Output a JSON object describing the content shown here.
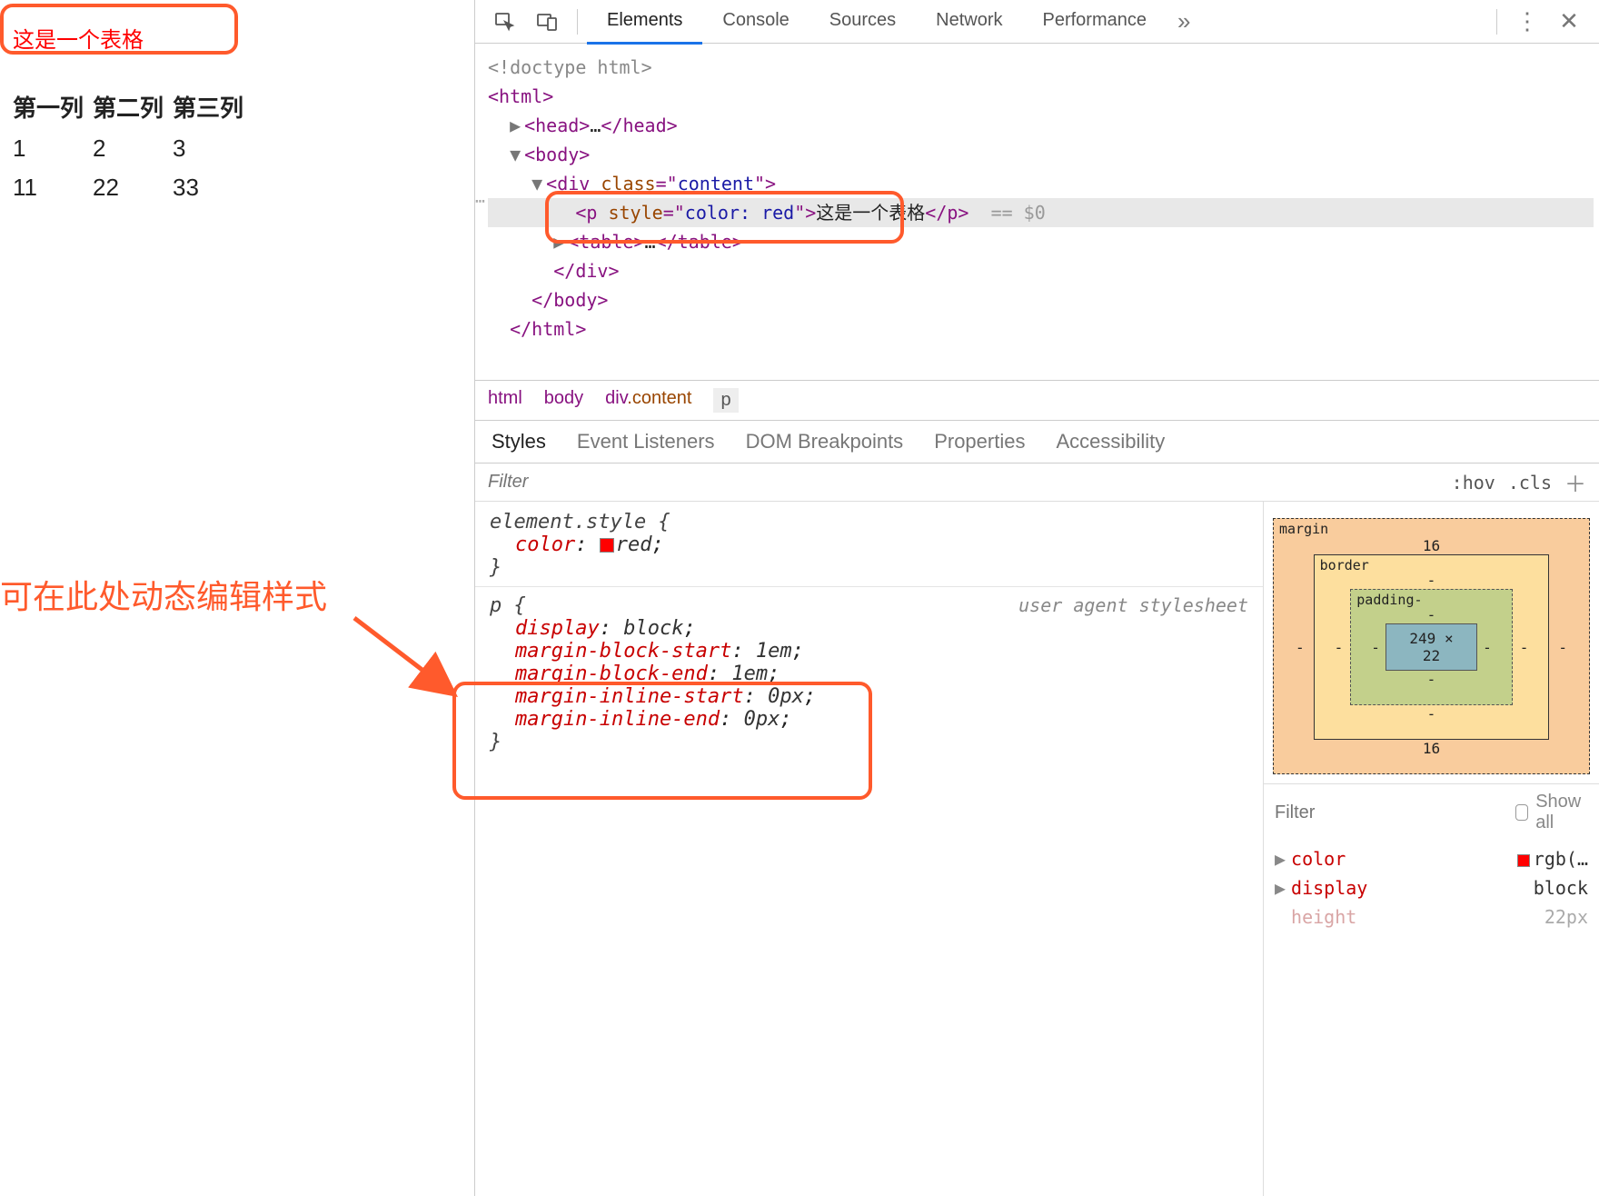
{
  "page": {
    "title": "这是一个表格",
    "headers": [
      "第一列",
      "第二列",
      "第三列"
    ],
    "rows": [
      [
        "1",
        "2",
        "3"
      ],
      [
        "11",
        "22",
        "33"
      ]
    ]
  },
  "annotation": {
    "label": "可在此处动态编辑样式"
  },
  "devtools": {
    "tabs": [
      "Elements",
      "Console",
      "Sources",
      "Network",
      "Performance"
    ],
    "active_tab": "Elements",
    "more": "»",
    "dom": {
      "doctype": "<!doctype html>",
      "html_open": "<html>",
      "head": {
        "open": "<head>",
        "ellipsis": "…",
        "close": "</head>"
      },
      "body_open": "<body>",
      "div_open_tag": "div",
      "div_attr_name": "class",
      "div_attr_val": "content",
      "p_tag": "p",
      "p_attr_name": "style",
      "p_attr_val": "color: red",
      "p_text": "这是一个表格",
      "p_close": "</p>",
      "selected_suffix": "== $0",
      "table": {
        "open": "<table>",
        "ellipsis": "…",
        "close": "</table>"
      },
      "div_close": "</div>",
      "body_close": "</body>",
      "html_close": "</html>"
    },
    "breadcrumb": {
      "items": [
        "html",
        "body",
        "div.content",
        "p"
      ]
    },
    "subtabs": [
      "Styles",
      "Event Listeners",
      "DOM Breakpoints",
      "Properties",
      "Accessibility"
    ],
    "active_subtab": "Styles",
    "filter_placeholder": "Filter",
    "hov": ":hov",
    "cls": ".cls",
    "rules": {
      "element_style": {
        "selector": "element.style {",
        "prop": "color",
        "val": "red",
        "close": "}"
      },
      "ua": {
        "selector": "p {",
        "source": "user agent stylesheet",
        "props": [
          {
            "k": "display",
            "v": "block"
          },
          {
            "k": "margin-block-start",
            "v": "1em"
          },
          {
            "k": "margin-block-end",
            "v": "1em"
          },
          {
            "k": "margin-inline-start",
            "v": "0px"
          },
          {
            "k": "margin-inline-end",
            "v": "0px"
          }
        ],
        "close": "}"
      }
    },
    "boxmodel": {
      "margin_label": "margin",
      "margin_top": "16",
      "margin_bottom": "16",
      "margin_side": "-",
      "border_label": "border",
      "border_val": "-",
      "padding_label": "padding-",
      "padding_val": "-",
      "content": "249 × 22"
    },
    "computed": {
      "filter_placeholder": "Filter",
      "show_all": "Show all",
      "rows": [
        {
          "k": "color",
          "v": "rgb(…",
          "swatch": true
        },
        {
          "k": "display",
          "v": "block"
        },
        {
          "k": "height",
          "v": "22px",
          "dim": true
        }
      ]
    }
  }
}
